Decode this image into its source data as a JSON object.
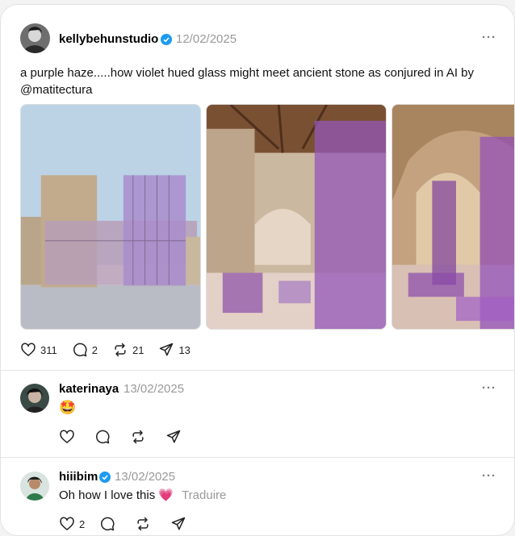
{
  "post": {
    "username": "kellybehunstudio",
    "date": "12/02/2025",
    "text": "a purple haze.....how violet hued glass might meet ancient stone as conjured in AI by @matitectura",
    "likes": "311",
    "comments": "2",
    "reposts": "21",
    "shares": "13"
  },
  "replies": [
    {
      "username": "katerinaya",
      "date": "13/02/2025",
      "text": "🤩"
    },
    {
      "username": "hiiibim",
      "date": "13/02/2025",
      "text": "Oh how I love this 💗",
      "translate": "Traduire",
      "likes": "2"
    }
  ],
  "colors": {
    "verified": "#1d9bf0",
    "accent_purple": "#9b59b6"
  }
}
